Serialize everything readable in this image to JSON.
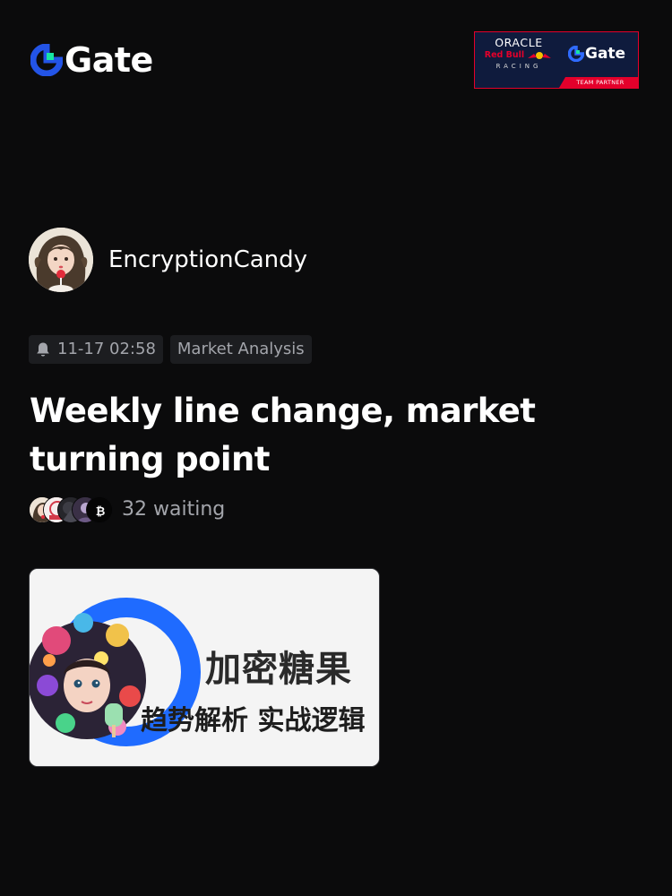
{
  "header": {
    "logo_text": "Gate",
    "logo_icon": "gate-logo-icon",
    "partner": {
      "oracle": "ORACLE",
      "redbull": "Red Bull",
      "racing": "RACING",
      "gate_text": "Gate",
      "team_partner": "TEAM PARTNER"
    }
  },
  "author": {
    "name": "EncryptionCandy",
    "avatar_icon": "author-avatar"
  },
  "meta": {
    "time_icon": "bell-icon",
    "time": "11-17 02:58",
    "category": "Market Analysis"
  },
  "post": {
    "title": "Weekly line change, market turning point"
  },
  "waiting": {
    "count_text": "32 waiting",
    "avatars": [
      "avatar-1",
      "avatar-2",
      "avatar-3",
      "avatar-4",
      "bitcoin-avatar"
    ],
    "bitcoin_symbol": "₿"
  },
  "cover": {
    "title": "加密糖果",
    "subtitle": "趋势解析 实战逻辑"
  },
  "colors": {
    "background": "#0b0b0c",
    "gate_blue": "#2354e6",
    "gate_green": "#17e5a2",
    "tag_bg": "#1c1d20",
    "muted_text": "#a3a5ab",
    "partner_navy": "#0f1b3d",
    "partner_red": "#e4002b"
  }
}
